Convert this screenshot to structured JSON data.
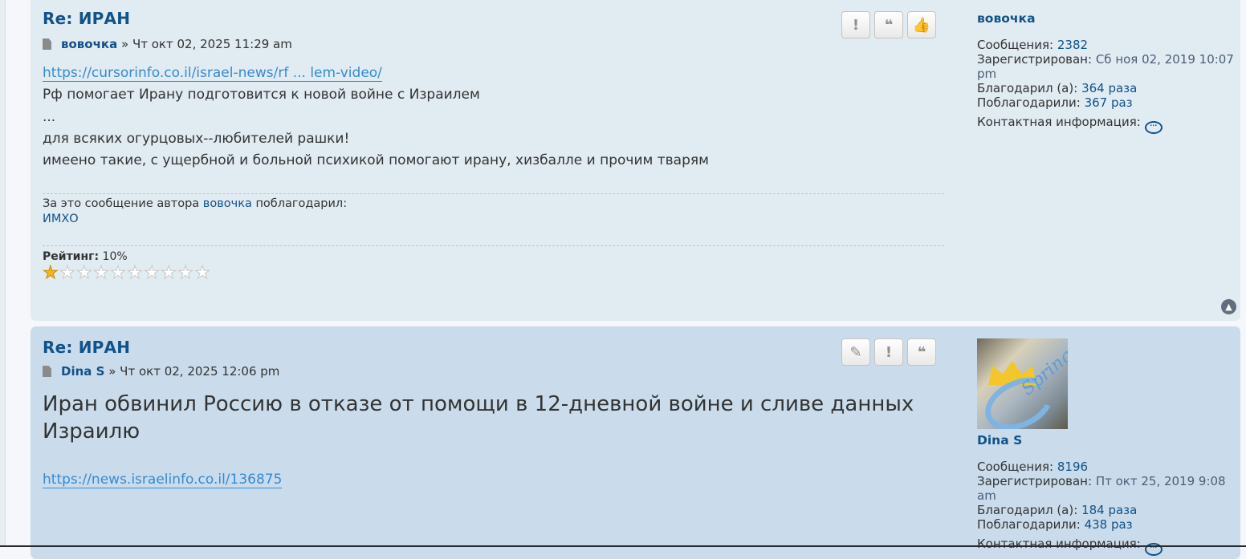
{
  "post1": {
    "title": "Re: ИРАН",
    "author": "вовочка",
    "sep": "»",
    "datetime": "Чт окт 02, 2025 11:29 am",
    "link": "https://cursorinfo.co.il/israel-news/rf ... lem-video/",
    "lines": [
      "Рф помогает Ирану подготовится к новой войне с Израилем",
      "...",
      "для всяких огурцовых--любителей рашки!",
      "имеено такие, с ущербной и больной психикой помогают ирану, хизбалле и прочим тварям"
    ],
    "thanks_prefix": "За это сообщение автора",
    "thanks_author": "вовочка",
    "thanks_suffix": "поблагодарил:",
    "thanks_user": "ИМХО",
    "rating_label": "Рейтинг:",
    "rating_value": "10%",
    "rating_fraction": 0.1,
    "buttons": [
      "!",
      "❝",
      "👍"
    ],
    "profile": {
      "username": "вовочка",
      "posts_label": "Сообщения:",
      "posts": "2382",
      "registered_label": "Зарегистрирован:",
      "registered": "Сб ноя 02, 2019 10:07 pm",
      "thanked_label": "Благодарил (а):",
      "thanked": "364 раза",
      "was_thanked_label": "Поблагодарили:",
      "was_thanked": "367 раз",
      "contact_label": "Контактная информация:"
    }
  },
  "post2": {
    "title": "Re: ИРАН",
    "author": "Dina S",
    "sep": "»",
    "datetime": "Чт окт 02, 2025 12:06 pm",
    "headline": "Иран обвинил Россию в отказе от помощи в 12-дневной войне и сливе данных Израилю",
    "link": "https://news.israelinfo.co.il/136875",
    "buttons": [
      "✎",
      "!",
      "❝"
    ],
    "profile": {
      "avatar_text": "Spring",
      "username": "Dina S",
      "posts_label": "Сообщения:",
      "posts": "8196",
      "registered_label": "Зарегистрирован:",
      "registered": "Пт окт 25, 2019 9:08 am",
      "thanked_label": "Благодарил (а):",
      "thanked": "184 раза",
      "was_thanked_label": "Поблагодарили:",
      "was_thanked": "438 раз",
      "contact_label": "Контактная информация:"
    }
  },
  "back_to_top_icon": "chevron-up-icon"
}
